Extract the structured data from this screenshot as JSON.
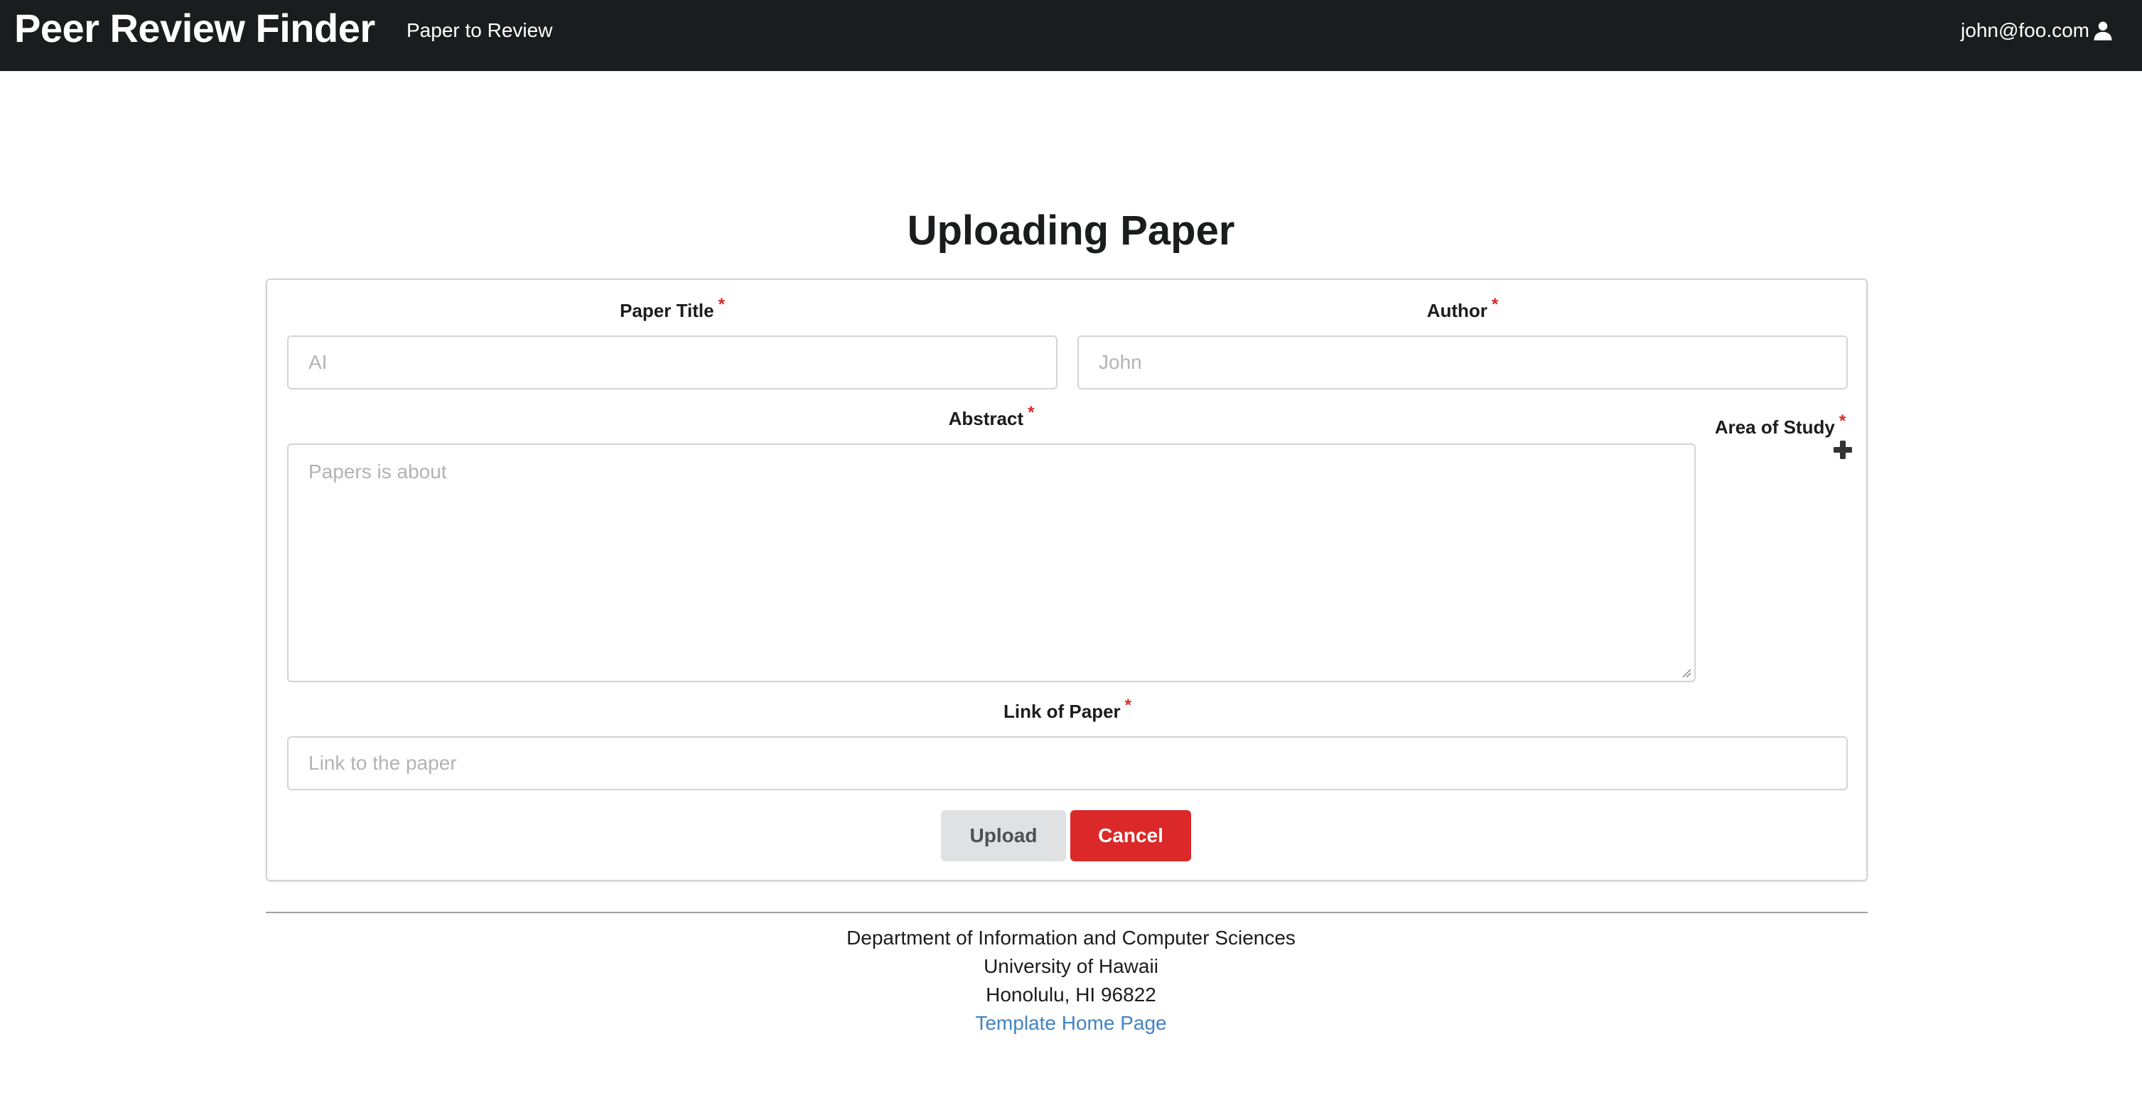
{
  "navbar": {
    "brand": "Peer Review Finder",
    "link": "Paper to Review",
    "user": "john@foo.com",
    "user_icon": "user-icon"
  },
  "page": {
    "title": "Uploading Paper"
  },
  "form": {
    "paper_title": {
      "label": "Paper Title",
      "required_mark": "*",
      "placeholder": "AI"
    },
    "author": {
      "label": "Author",
      "required_mark": "*",
      "placeholder": "John"
    },
    "abstract": {
      "label": "Abstract",
      "required_mark": "*",
      "placeholder": "Papers is about"
    },
    "area_of_study": {
      "label": "Area of Study",
      "required_mark": "*",
      "add_icon": "plus-icon"
    },
    "link": {
      "label": "Link of Paper",
      "required_mark": "*",
      "placeholder": "Link to the paper"
    },
    "upload_label": "Upload",
    "cancel_label": "Cancel"
  },
  "footer": {
    "line1": "Department of Information and Computer Sciences",
    "line2": "University of Hawaii",
    "line3": "Honolulu, HI 96822",
    "link": "Template Home Page"
  },
  "colors": {
    "navbar": "#1b1c1d",
    "required": "#db2828",
    "cancel": "#db2828",
    "upload": "#e0e1e2",
    "link": "#4183c4"
  }
}
